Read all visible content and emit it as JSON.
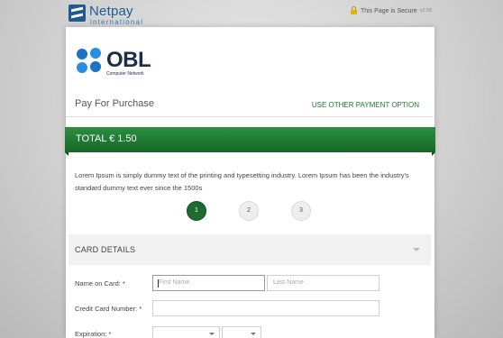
{
  "header": {
    "brand_name": "Netpay",
    "brand_sub": "international",
    "secure_text": "This Page is Secure",
    "version": "v2.58"
  },
  "merchant": {
    "name": "OBL",
    "subtitle": "Computer Network"
  },
  "payment": {
    "title": "Pay For Purchase",
    "other_option_label": "USE OTHER PAYMENT OPTION",
    "total": "TOTAL € 1.50",
    "description": "Lorem Ipsum is simply dummy text of the printing and typesetting industry. Lorem Ipsum has been the industry's standard dummy text ever since the 1500s"
  },
  "steps": [
    "1",
    "2",
    "3"
  ],
  "card_details": {
    "title": "CARD DETAILS",
    "name_label": "Name on Card: *",
    "first_name_placeholder": "First Name",
    "last_name_placeholder": "Last Name",
    "card_number_label": "Credit Card Number: *",
    "card_number_placeholder": "",
    "expiration_label": "Expiration: *"
  },
  "colors": {
    "accent_green": "#1a7a35",
    "brand_blue": "#1e5a94"
  }
}
